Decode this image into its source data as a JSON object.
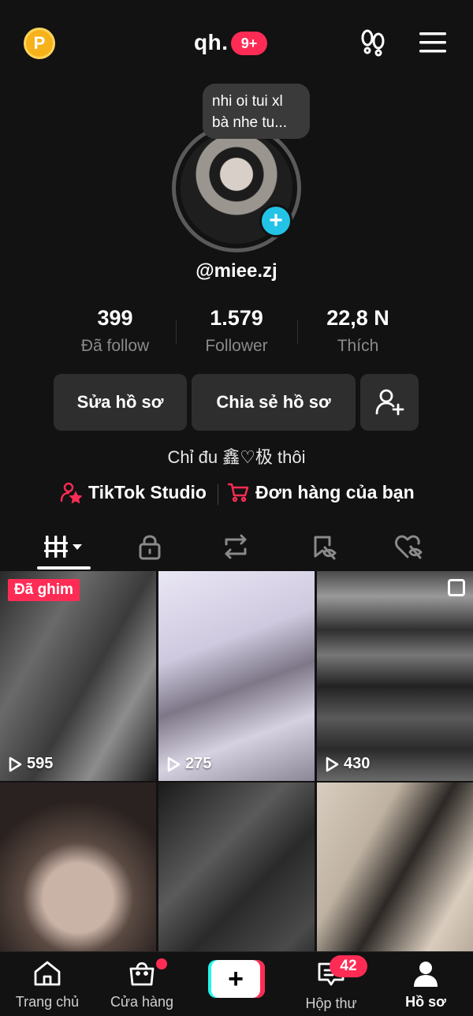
{
  "header": {
    "points_label": "P",
    "username": "qh.",
    "notification_badge": "9+"
  },
  "note": {
    "text": "nhi oi tui xl\nbà nhe tu..."
  },
  "profile": {
    "handle": "@miee.zj",
    "bio": "Chỉ đu 鑫♡极 thôi"
  },
  "stats": [
    {
      "value": "399",
      "label": "Đã follow"
    },
    {
      "value": "1.579",
      "label": "Follower"
    },
    {
      "value": "22,8 N",
      "label": "Thích"
    }
  ],
  "buttons": {
    "edit_profile": "Sửa hồ sơ",
    "share_profile": "Chia sẻ hồ sơ"
  },
  "links": {
    "studio": "TikTok Studio",
    "orders": "Đơn hàng của bạn"
  },
  "tabs": [
    {
      "icon": "grid-icon",
      "active": true
    },
    {
      "icon": "lock-icon",
      "active": false
    },
    {
      "icon": "repost-icon",
      "active": false
    },
    {
      "icon": "saved-icon",
      "active": false
    },
    {
      "icon": "liked-icon",
      "active": false
    }
  ],
  "videos": [
    {
      "views": "595",
      "pinned_label": "Đã ghim"
    },
    {
      "views": "275"
    },
    {
      "views": "430",
      "multi": true
    },
    {
      "views": ""
    },
    {
      "views": ""
    },
    {
      "views": ""
    }
  ],
  "bottom_nav": {
    "home": "Trang chủ",
    "shop": "Cửa hàng",
    "inbox": "Hộp thư",
    "inbox_badge": "42",
    "profile": "Hồ sơ"
  },
  "colors": {
    "background": "#121212",
    "accent": "#fe2c55",
    "cyan": "#25f4ee"
  }
}
